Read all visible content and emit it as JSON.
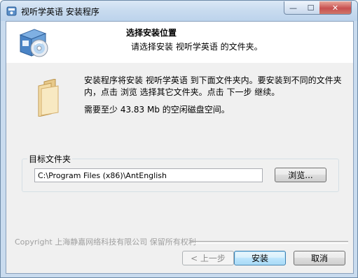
{
  "window": {
    "title": "视听学英语 安装程序",
    "controls": {
      "minimize": "—",
      "maximize": "☐",
      "close": "✕"
    }
  },
  "header": {
    "title": "选择安装位置",
    "subtitle": "请选择安装 视听学英语 的文件夹。"
  },
  "body": {
    "description": "安装程序将安装 视听学英语 到下面文件夹内。要安装到不同的文件夹内，点击 浏览 选择其它文件夹。点击 下一步 继续。",
    "space_required": "需要至少 43.83 Mb 的空闲磁盘空间。"
  },
  "destination": {
    "group_label": "目标文件夹",
    "path": "C:\\Program Files (x86)\\AntEnglish",
    "browse_label": "浏览..."
  },
  "footer": {
    "copyright": "Copyright 上海静嘉网络科技有限公司 保留所有权利",
    "back_label": "< 上一步",
    "install_label": "安装",
    "cancel_label": "取消"
  },
  "colors": {
    "title_bar": "#c8dbef",
    "close_button": "#c75050",
    "dialog_bg": "#f0f0f0",
    "default_button_border": "#3c7fb1"
  }
}
